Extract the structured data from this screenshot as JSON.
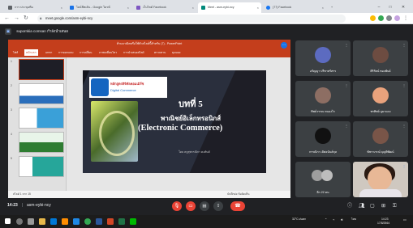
{
  "browser": {
    "tabs": [
      {
        "label": "การ ประชุมทีม",
        "color": "#5f6368"
      },
      {
        "label": "ไลน์ชีทเดิน - Google ไดรฟ์",
        "color": "#1a73e8"
      },
      {
        "label": "เว็บไซต์ Facebook",
        "color": "#7e57c2"
      },
      {
        "label": "Meet - asm-eybi-ncy",
        "color": "#00897b"
      },
      {
        "label": "(77) Facebook",
        "color": "#1877f2"
      }
    ],
    "url": "meet.google.com/asm-eybi-ncy"
  },
  "meet": {
    "presenter_label": "supornkia comsan กำลังนำเสนอ",
    "meeting_time": "14:23",
    "meeting_code": "asm-eybi-ncy"
  },
  "powerpoint": {
    "title": "ห้ามมาณิตหรือใช้ตัวสไลด์นี้สำหรับ (7) - PowerPoint",
    "ribbon_tabs": [
      "ไฟล์",
      "หน้าแรก",
      "แทรก",
      "การออกแบบ",
      "การเปลี่ยน",
      "ภาพเคลื่อนไหว",
      "การนำเสนอสไลด์",
      "ตรวจทาน",
      "มุมมอง"
    ],
    "slide_count": [
      "1",
      "2",
      "3",
      "4",
      "5"
    ],
    "status_left": "สไลด์ 1 จาก 15",
    "status_right": "บันทึกย่อ   ข้อคิดเห็น"
  },
  "slide": {
    "logo_line1": "หลักสูตรดิจิทัลคอมเมิร์ซ",
    "logo_line2": "Digital Commerce",
    "chapter": "บทที่ 5",
    "subtitle_thai": "พาณิชย์อิเล็กทรอนิกส์",
    "subtitle_en": "(Electronic Commerce)",
    "author": "โดย ครูสุพรรณิกา คงสันต์"
  },
  "participants": [
    {
      "name": "อรัญญา ปรีชาสรัสรร",
      "video": false,
      "avatar_color": "#5c6bc0"
    },
    {
      "name": "ศิริรัตน์ ทองพันธ์",
      "video": false,
      "avatar_color": "#6d4c41"
    },
    {
      "name": "ทิพย์วรรณ หนองไร",
      "video": false,
      "avatar_color": "#8d6e63"
    },
    {
      "name": "พรทิพย์ ภูผาแดง",
      "video": false,
      "avatar_color": "#a1887f"
    },
    {
      "name": "กรรณิกา เลิศอนันต์กุล",
      "video": false,
      "avatar_color": "#263238"
    },
    {
      "name": "พัชราภรณ์ บุญพิพัฒน์",
      "video": false,
      "avatar_color": "#795548"
    },
    {
      "name": "อีก 22 คน",
      "video": false,
      "avatar_color": "#9e9e9e"
    },
    {
      "name": "",
      "video": true,
      "avatar_color": "#e8b896"
    }
  ],
  "taskbar": {
    "weather": "32°C ฝนตก",
    "lang": "ไทย",
    "clock_time": "14:23",
    "clock_date": "17/8/2564"
  }
}
